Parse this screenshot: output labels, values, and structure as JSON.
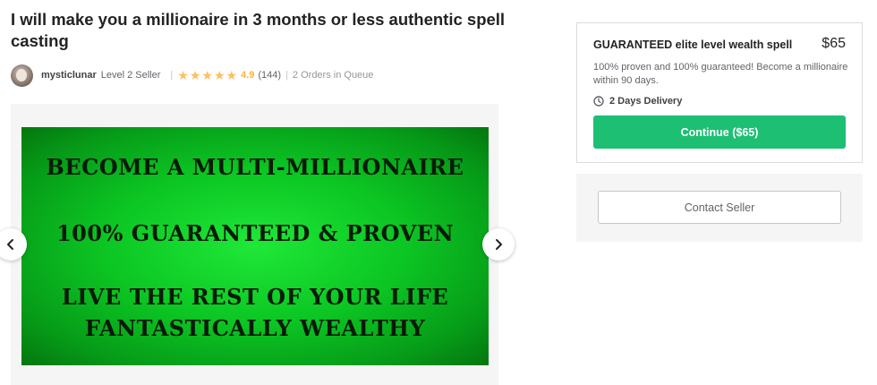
{
  "gig": {
    "title": "I will make you a millionaire in 3 months or less authentic spell casting"
  },
  "seller": {
    "name": "mysticlunar",
    "level": "Level 2 Seller",
    "rating": "4.9",
    "stars": 5,
    "review_count": "(144)",
    "queue": "2 Orders in Queue"
  },
  "gallery": {
    "slide_lines": [
      "BECOME A MULTI-MILLIONAIRE",
      "100% GUARANTEED & PROVEN",
      "LIVE THE REST OF YOUR LIFE",
      "FANTASTICALLY WEALTHY"
    ]
  },
  "package": {
    "title": "GUARANTEED elite level wealth spell",
    "price": "$65",
    "description": "100% proven and 100% guaranteed! Become a millionaire within 90 days.",
    "delivery": "2 Days Delivery",
    "continue_label": "Continue ($65)"
  },
  "contact": {
    "label": "Contact Seller"
  },
  "colors": {
    "accent": "#1dbf73",
    "star": "#ffbe5b",
    "rating": "#ffb33e"
  }
}
